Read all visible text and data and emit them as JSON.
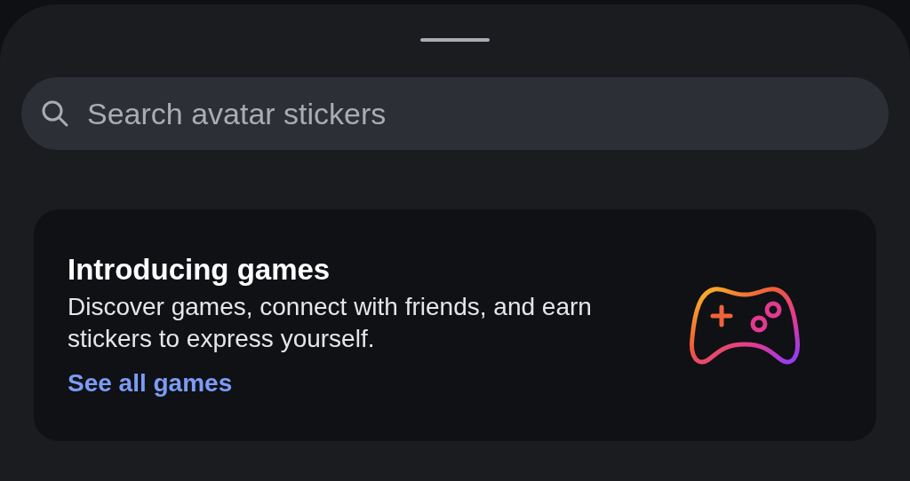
{
  "search": {
    "placeholder": "Search avatar stickers"
  },
  "promo_card": {
    "title": "Introducing games",
    "description": "Discover games, connect with friends, and earn stickers to express yourself.",
    "link": "See all games"
  }
}
